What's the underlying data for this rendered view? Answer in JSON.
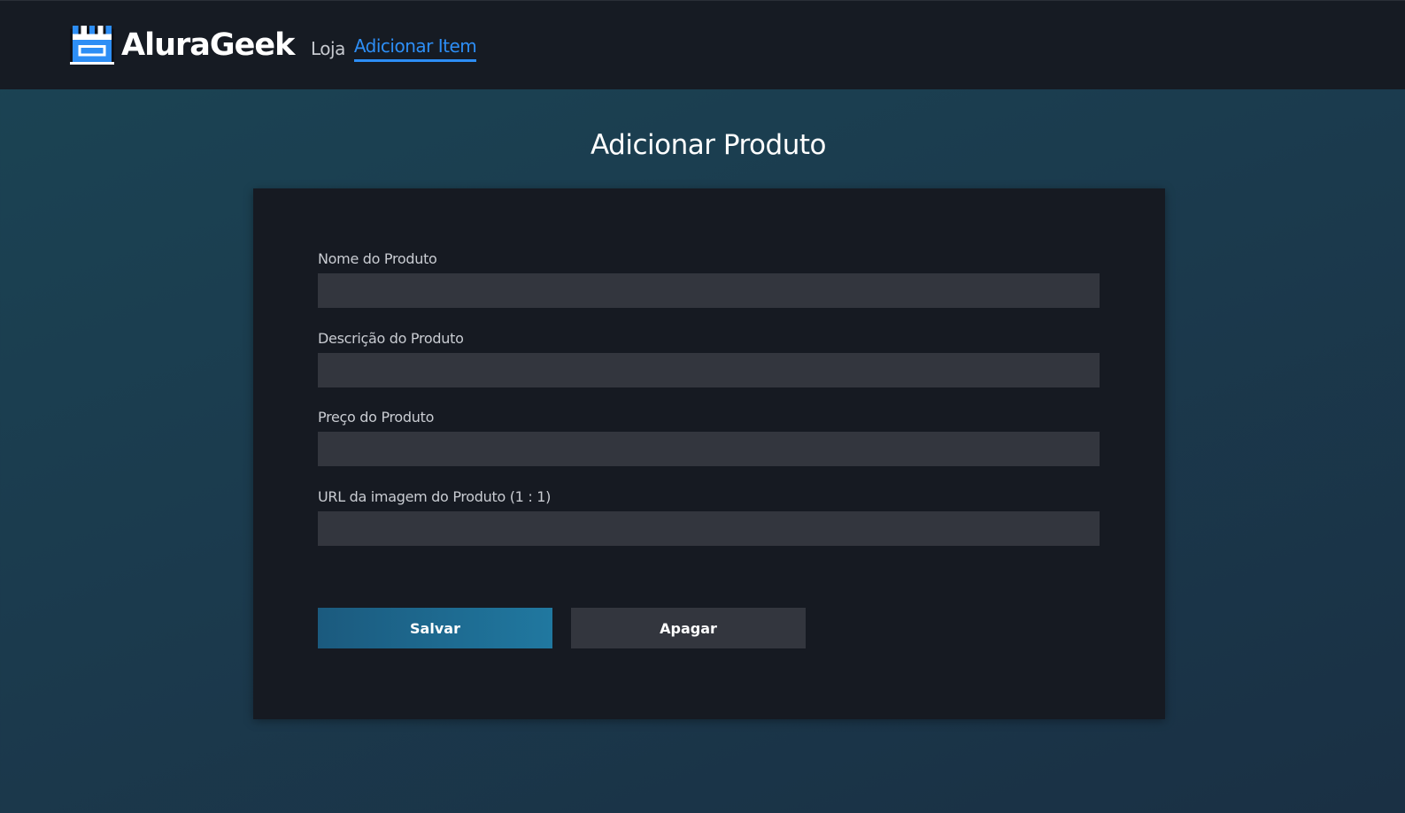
{
  "header": {
    "brand": "AluraGeek",
    "logo_icon": "storefront-icon",
    "nav": {
      "loja": "Loja",
      "adicionar_item": "Adicionar Item"
    }
  },
  "main": {
    "title": "Adicionar Produto",
    "form": {
      "nome_label": "Nome do Produto",
      "nome_value": "",
      "descricao_label": "Descrição do Produto",
      "descricao_value": "",
      "preco_label": "Preço do Produto",
      "preco_value": "",
      "url_label": "URL da imagem do Produto (1 : 1)",
      "url_value": "",
      "save_label": "Salvar",
      "clear_label": "Apagar"
    }
  },
  "colors": {
    "accent": "#2d8ef5",
    "header_bg": "#161b23",
    "card_bg": "#161a22",
    "input_bg": "#33363e",
    "save_button": "#2078a0"
  }
}
